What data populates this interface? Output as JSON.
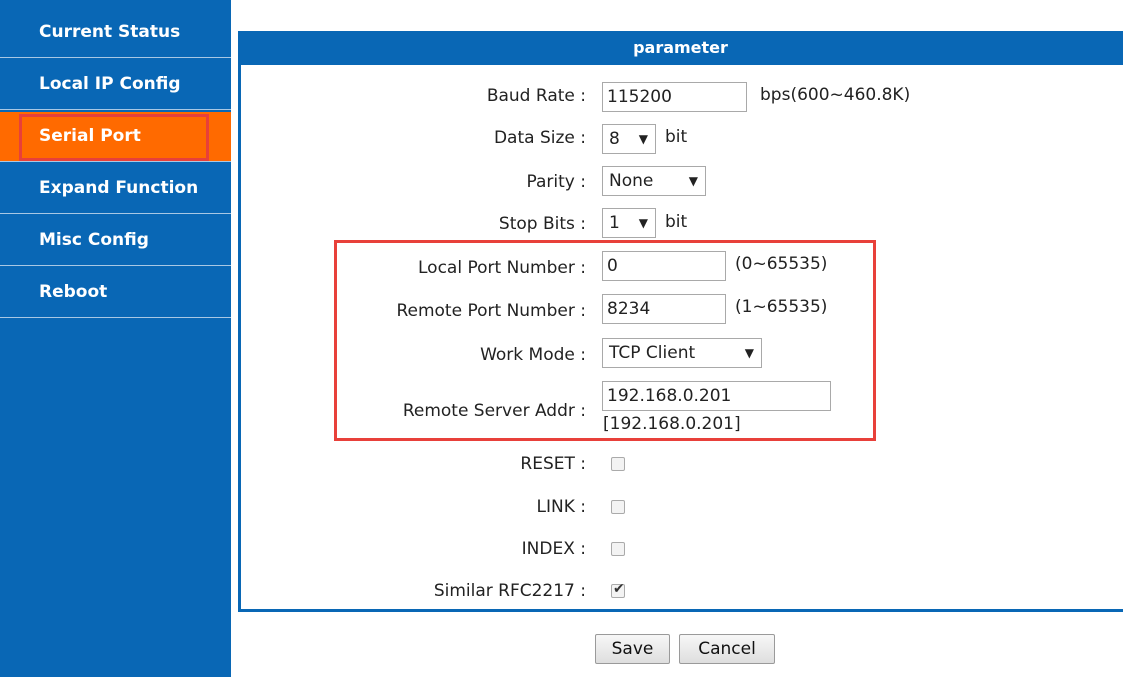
{
  "sidebar": {
    "items": [
      {
        "label": "Current Status"
      },
      {
        "label": "Local IP Config"
      },
      {
        "label": "Serial Port"
      },
      {
        "label": "Expand Function"
      },
      {
        "label": "Misc Config"
      },
      {
        "label": "Reboot"
      }
    ],
    "active_index": 2
  },
  "panel": {
    "title": "parameter"
  },
  "form": {
    "baud_rate": {
      "label": "Baud Rate :",
      "value": "115200",
      "unit": "bps(600~460.8K)"
    },
    "data_size": {
      "label": "Data Size :",
      "value": "8",
      "unit": "bit"
    },
    "parity": {
      "label": "Parity :",
      "value": "None"
    },
    "stop_bits": {
      "label": "Stop Bits :",
      "value": "1",
      "unit": "bit"
    },
    "local_port": {
      "label": "Local Port Number :",
      "value": "0",
      "range": "(0~65535)"
    },
    "remote_port": {
      "label": "Remote Port Number :",
      "value": "8234",
      "range": "(1~65535)"
    },
    "work_mode": {
      "label": "Work Mode :",
      "value": "TCP Client"
    },
    "remote_server": {
      "label": "Remote Server Addr :",
      "value": "192.168.0.201",
      "resolved": "[192.168.0.201]"
    },
    "reset": {
      "label": "RESET :",
      "checked": false
    },
    "link": {
      "label": "LINK :",
      "checked": false
    },
    "index": {
      "label": "INDEX :",
      "checked": false
    },
    "rfc2217": {
      "label": "Similar RFC2217 :",
      "checked": true
    }
  },
  "actions": {
    "save_label": "Save",
    "cancel_label": "Cancel"
  },
  "colors": {
    "brand_blue": "#0967b5",
    "active_orange": "#ff6a00",
    "highlight_red": "#e8403a"
  }
}
